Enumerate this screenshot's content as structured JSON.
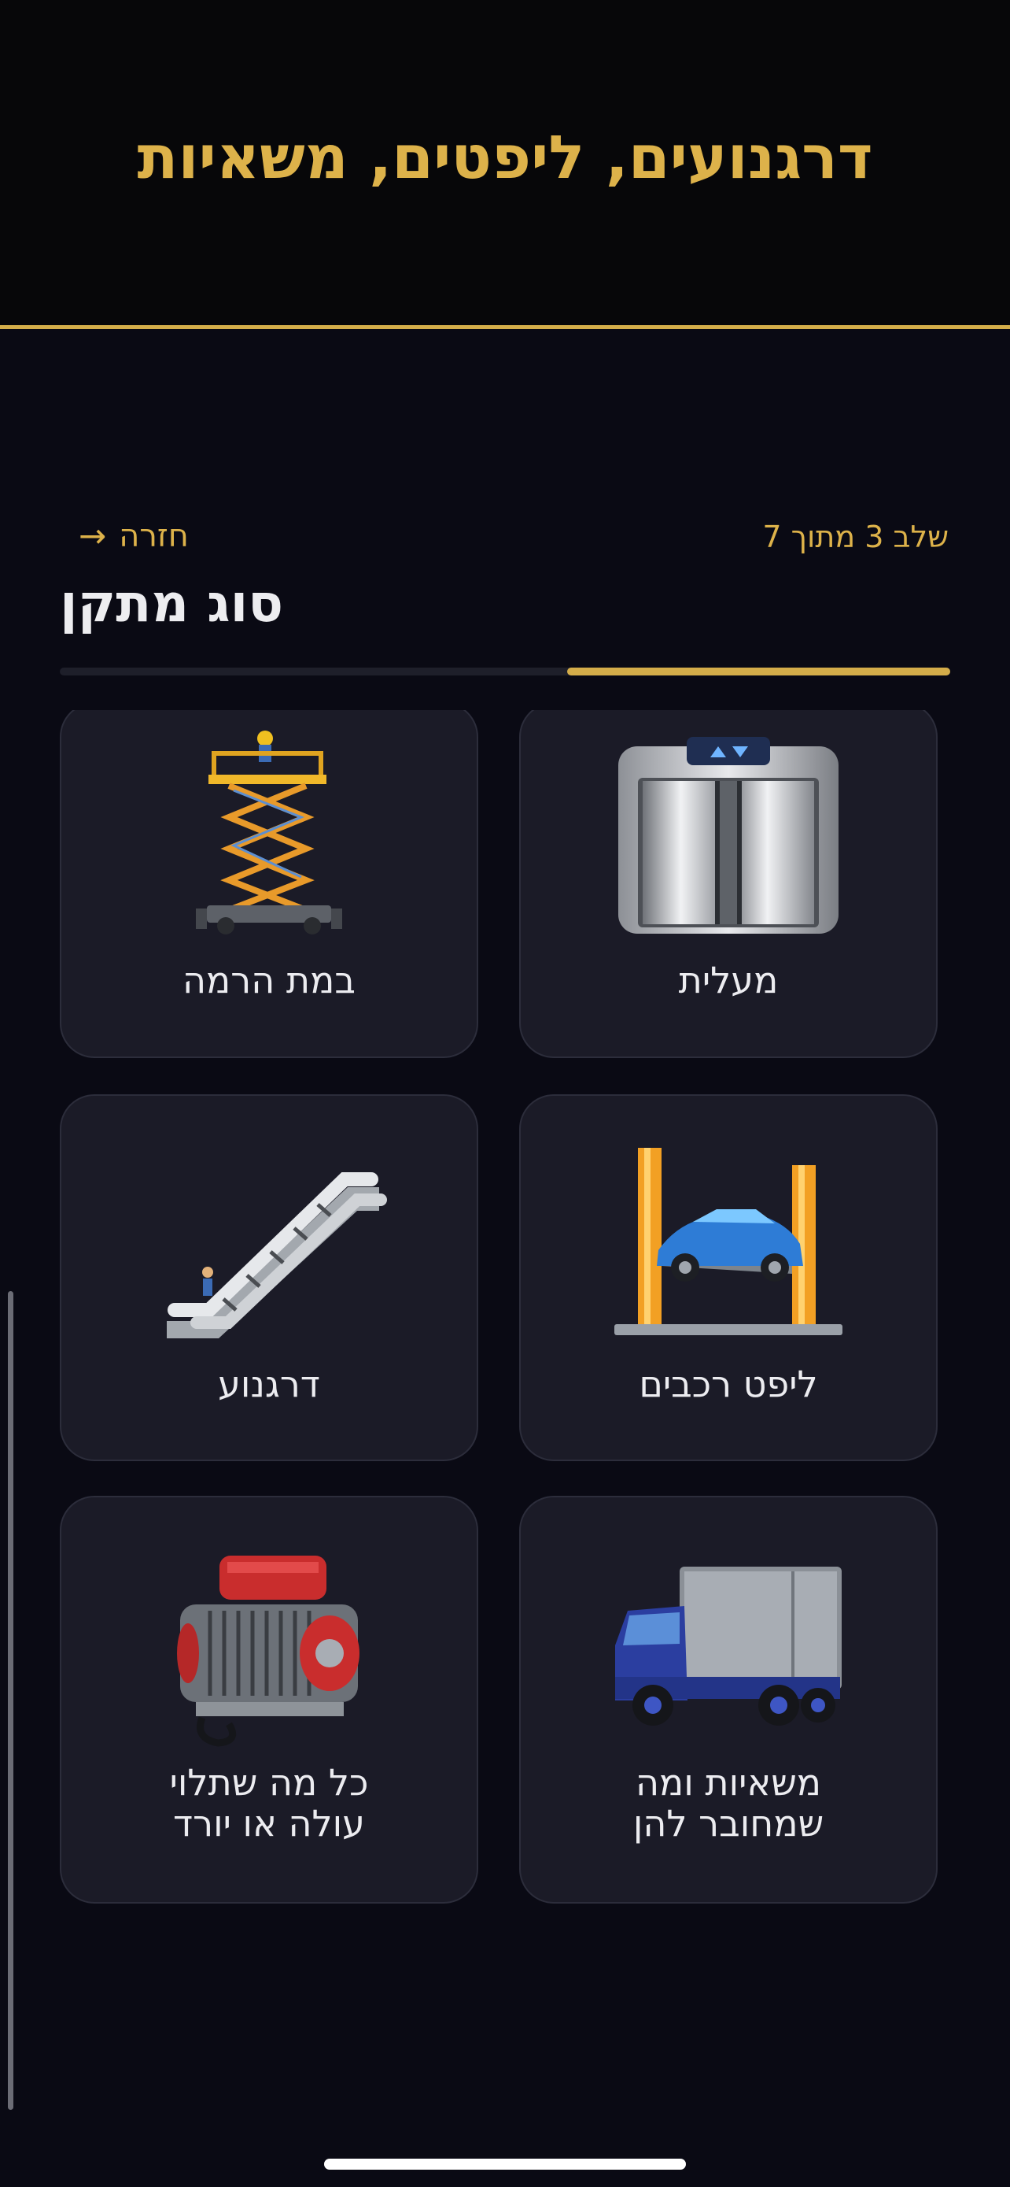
{
  "header": {
    "title": "דרגנועים, ליפטים, משאיות"
  },
  "nav": {
    "step_label": "שלב 3 מתוך 7",
    "back_label": "חזרה",
    "back_arrow": "→"
  },
  "page": {
    "title": "סוג מתקן"
  },
  "progress": {
    "current_step": 3,
    "total_steps": 7,
    "fraction": 0.43
  },
  "options": [
    {
      "label": "מעלית",
      "icon": "elevator-icon"
    },
    {
      "label": "במת הרמה",
      "icon": "scissor-lift-icon"
    },
    {
      "label": "ליפט רכבים",
      "icon": "car-lift-icon"
    },
    {
      "label": "דרגנוע",
      "icon": "escalator-icon"
    },
    {
      "label": "משאיות ומה",
      "label_line2": "שמחובר להן",
      "icon": "truck-icon"
    },
    {
      "label": "כל מה שתלוי",
      "label_line2": "עולה או יורד",
      "icon": "winch-icon"
    }
  ],
  "colors": {
    "accent": "#d4ad4a",
    "background": "#0a0a14",
    "card": "#1b1b27",
    "header": "#070709"
  }
}
